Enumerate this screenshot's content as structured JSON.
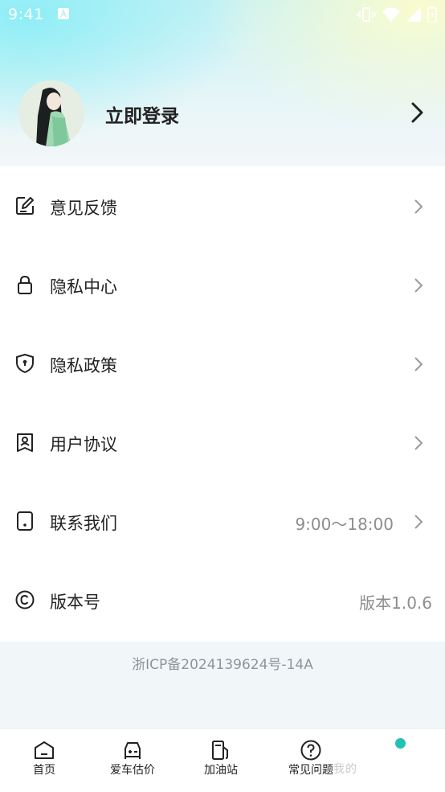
{
  "status_bar": {
    "time": "9:41"
  },
  "profile": {
    "login_label": "立即登录"
  },
  "menu": [
    {
      "label": "意见反馈",
      "value": ""
    },
    {
      "label": "隐私中心",
      "value": ""
    },
    {
      "label": "隐私政策",
      "value": ""
    },
    {
      "label": "用户协议",
      "value": ""
    },
    {
      "label": "联系我们",
      "value": "9:00～18:00"
    },
    {
      "label": "版本号",
      "value": "版本1.0.6"
    }
  ],
  "icp": "浙ICP备2024139624号-14A",
  "tabs": [
    {
      "label": "首页"
    },
    {
      "label": "爱车估价"
    },
    {
      "label": "加油站"
    },
    {
      "label": "常见问题"
    },
    {
      "label": "我的"
    }
  ],
  "colors": {
    "accent": "#1fc2b4",
    "secondary_text": "#8d8d8d"
  }
}
